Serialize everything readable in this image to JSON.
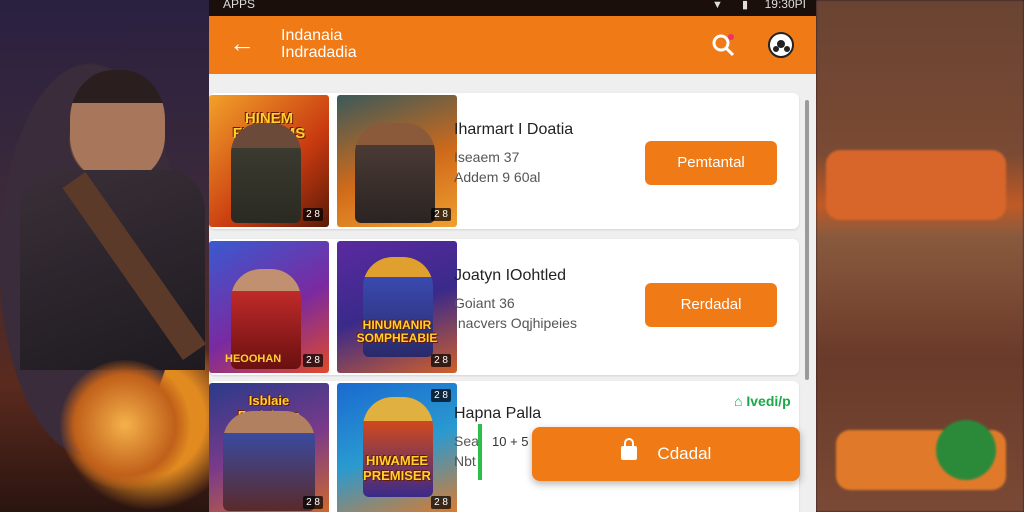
{
  "statusbar": {
    "left": "APPS",
    "time": "19:30PI"
  },
  "appbar": {
    "title_line1": "Indanaia",
    "title_line2": "Indradadia",
    "back_icon": "back-arrow-icon",
    "search_icon": "search-icon",
    "profile_icon": "soccer-ball-icon"
  },
  "items": [
    {
      "title": "Iharmart I Doatia",
      "line1": "Iseaem 37",
      "line2": "Addem 9 60al",
      "button": "Pemtantal",
      "thumb1_banner": "HINEM FLEKAMS",
      "thumb1_badge": "2 8",
      "thumb2_badge": "2 8"
    },
    {
      "title": "Joatyn IOohtled",
      "line1": "Goiant 36",
      "line2": "Inacvers Oqjhipeies",
      "button": "Rerdadal",
      "thumb1_caption": "HEOOHAN",
      "thumb1_badge": "2 8",
      "thumb2_banner": "HINUMANIR SOMPHEABIE",
      "thumb2_badge": "2 8"
    },
    {
      "title": "Hapna Palla",
      "line1": "Sea",
      "line2": "Nbt",
      "thumb1_banner": "Isblaie Rerishess",
      "thumb1_badge": "2 8",
      "thumb2_banner": "HIWAMEE PREMISER",
      "thumb2_badge": "2 8",
      "thumb2_top_badge": "2 8"
    }
  ],
  "verified": "Ivedi/p",
  "toast_text": "10 + 5",
  "fab_label": "Cdadal",
  "fab_icon": "lock-icon"
}
